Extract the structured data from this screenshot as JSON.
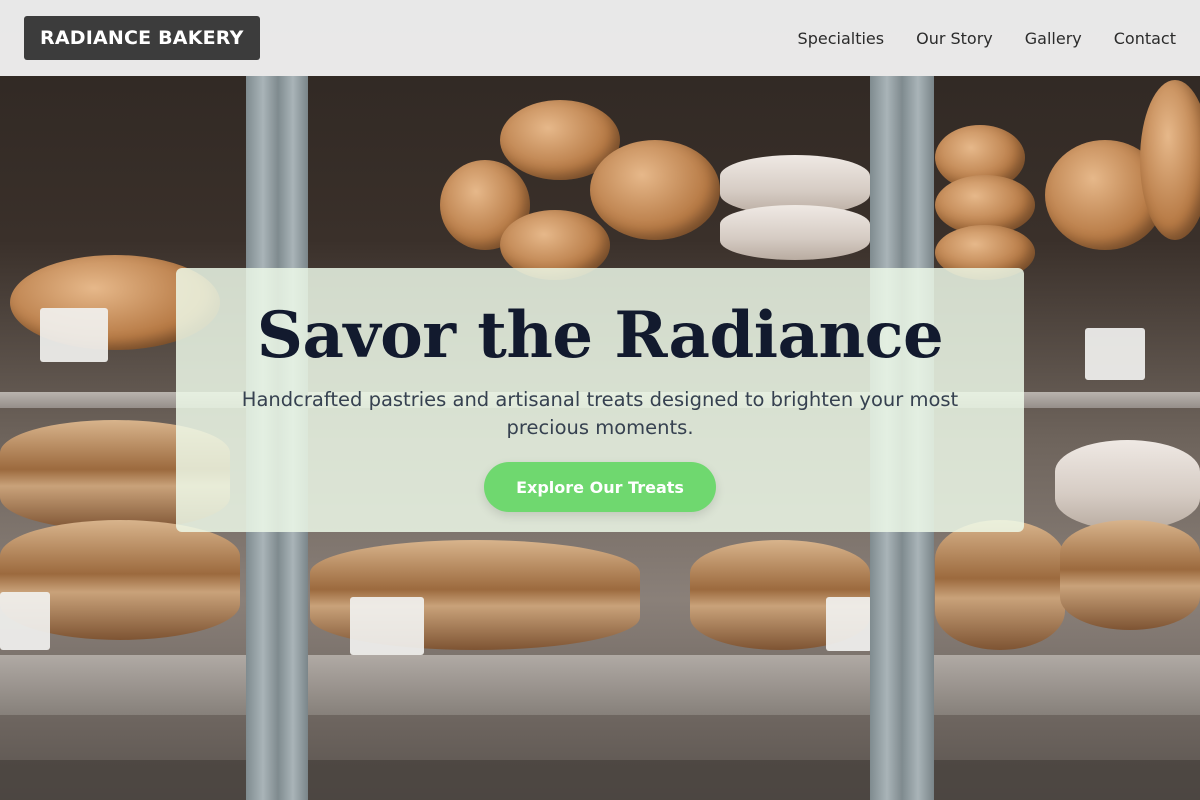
{
  "brand": {
    "name": "RADIANCE BAKERY"
  },
  "nav": {
    "items": [
      {
        "label": "Specialties"
      },
      {
        "label": "Our Story"
      },
      {
        "label": "Gallery"
      },
      {
        "label": "Contact"
      }
    ]
  },
  "hero": {
    "title": "Savor the Radiance",
    "subtitle": "Handcrafted pastries and artisanal treats designed to brighten your most precious moments.",
    "cta_label": "Explore Our Treats",
    "background": "bakery display case with croissants and pastries"
  },
  "colors": {
    "header_bg": "#f4f4f4",
    "logo_bg": "#3c3c3c",
    "title": "#121a2e",
    "subtitle": "#364150",
    "cta_bg": "#6fd86f",
    "card_bg": "#eefae9"
  }
}
